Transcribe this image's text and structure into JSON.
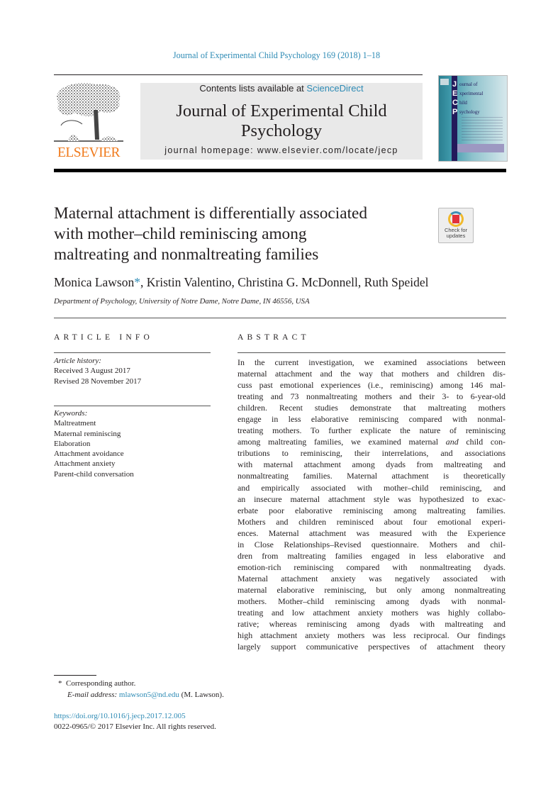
{
  "header": {
    "citation": "Journal of Experimental Child Psychology 169 (2018) 1–18",
    "contents_prefix": "Contents lists available at ",
    "contents_link": "ScienceDirect",
    "journal_title_line1": "Journal of Experimental Child",
    "journal_title_line2": "Psychology",
    "homepage_label": "journal homepage: ",
    "homepage_url": "www.elsevier.com/locate/jecp",
    "publisher_logo_text": "ELSEVIER",
    "cover": {
      "letters": [
        "J",
        "E",
        "C",
        "P"
      ],
      "words": [
        "ournal of",
        "xperimental",
        "hild",
        "sychology"
      ]
    },
    "colors": {
      "link": "#2e8bb5",
      "elsevier_orange": "#f07a1c"
    }
  },
  "article": {
    "title_lines": [
      "Maternal attachment is differentially associated",
      "with mother–child reminiscing among",
      "maltreating and nonmaltreating families"
    ],
    "check_updates_line1": "Check for",
    "check_updates_line2": "updates",
    "authors": {
      "first": "Monica Lawson",
      "marker": "*",
      "rest": ", Kristin Valentino, Christina G. McDonnell, Ruth Speidel"
    },
    "affiliation": "Department of Psychology, University of Notre Dame, Notre Dame, IN 46556, USA"
  },
  "article_info": {
    "heading": "ARTICLE INFO",
    "history_label": "Article history:",
    "received": "Received 3 August 2017",
    "revised": "Revised 28 November 2017",
    "keywords_label": "Keywords:",
    "keywords": [
      "Maltreatment",
      "Maternal reminiscing",
      "Elaboration",
      "Attachment avoidance",
      "Attachment anxiety",
      "Parent-child conversation"
    ]
  },
  "abstract": {
    "heading": "ABSTRACT",
    "lines": [
      "In the current investigation, we examined associations between",
      "maternal attachment and the way that mothers and children dis-",
      "cuss past emotional experiences (i.e., reminiscing) among 146 mal-",
      "treating and 73 nonmaltreating mothers and their 3- to 6-year-old",
      "children. Recent studies demonstrate that maltreating mothers",
      "engage in less elaborative reminiscing compared with nonmal-",
      "treating mothers. To further explicate the nature of reminiscing",
      "among maltreating families, we examined maternal |and| child con-",
      "tributions to reminiscing, their interrelations, and associations",
      "with maternal attachment among dyads from maltreating and",
      "nonmaltreating families. Maternal attachment is theoretically",
      "and empirically associated with mother–child reminiscing, and",
      "an insecure maternal attachment style was hypothesized to exac-",
      "erbate poor elaborative reminiscing among maltreating families.",
      "Mothers and children reminisced about four emotional experi-",
      "ences. Maternal attachment was measured with the Experience",
      "in Close Relationships–Revised questionnaire. Mothers and chil-",
      "dren from maltreating families engaged in less elaborative and",
      "emotion-rich reminiscing compared with nonmaltreating dyads.",
      "Maternal attachment anxiety was negatively associated with",
      "maternal elaborative reminiscing, but only among nonmaltreating",
      "mothers. Mother–child reminiscing among dyads with nonmal-",
      "treating and low attachment anxiety mothers was highly collabo-",
      "rative; whereas reminiscing among dyads with maltreating and",
      "high attachment anxiety mothers was less reciprocal. Our findings",
      "largely support communicative perspectives of attachment theory"
    ]
  },
  "footnotes": {
    "corresponding_marker": "*",
    "corresponding": "Corresponding author.",
    "email_label": "E-mail address:",
    "email": "mlawson5@nd.edu",
    "email_suffix": " (M. Lawson).",
    "doi": "https://doi.org/10.1016/j.jecp.2017.12.005",
    "copyright": "0022-0965/© 2017 Elsevier Inc. All rights reserved."
  }
}
